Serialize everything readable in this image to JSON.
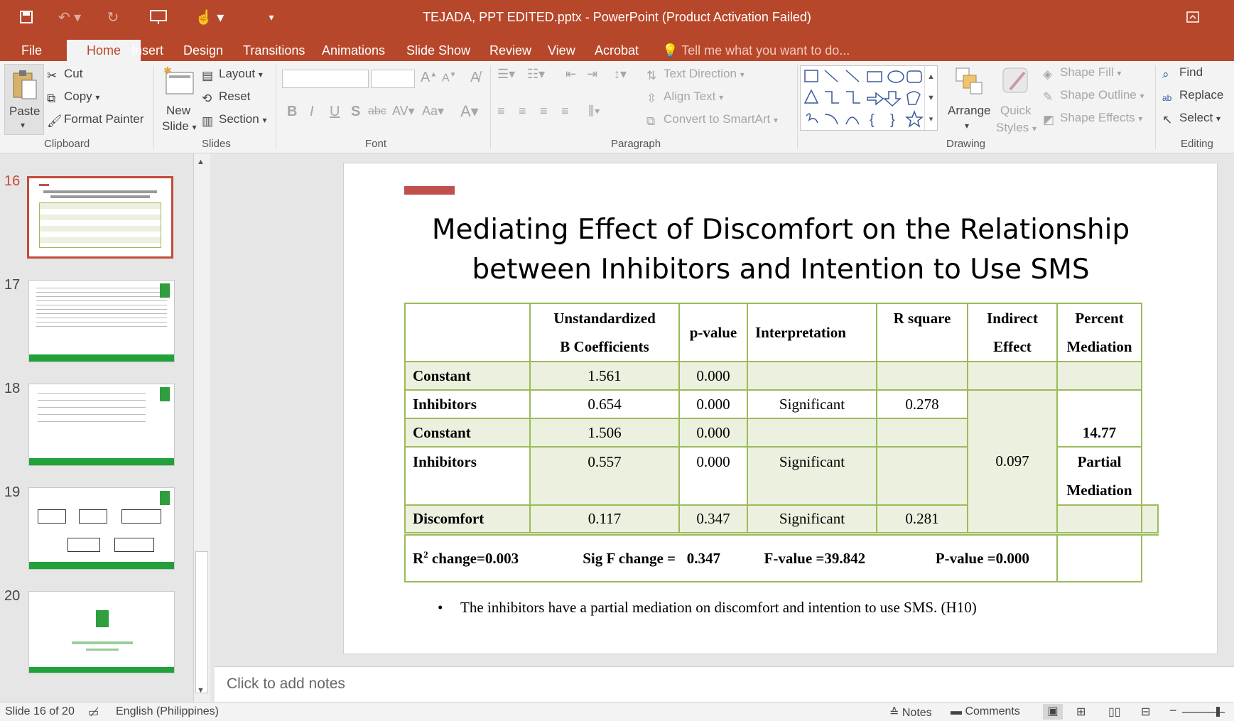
{
  "window": {
    "title": "TEJADA, PPT EDITED.pptx - PowerPoint (Product Activation Failed)"
  },
  "tabs": [
    "File",
    "Home",
    "Insert",
    "Design",
    "Transitions",
    "Animations",
    "Slide Show",
    "Review",
    "View",
    "Acrobat"
  ],
  "tell_me": "Tell me what you want to do...",
  "clipboard": {
    "paste": "Paste",
    "cut": "Cut",
    "copy": "Copy",
    "format_painter": "Format Painter",
    "group": "Clipboard"
  },
  "slides_grp": {
    "new": "New",
    "slide": "Slide",
    "layout": "Layout",
    "reset": "Reset",
    "section": "Section",
    "group": "Slides"
  },
  "font_grp": {
    "group": "Font"
  },
  "paragraph": {
    "text_direction": "Text Direction",
    "align_text": "Align Text",
    "convert": "Convert to SmartArt",
    "group": "Paragraph"
  },
  "drawing": {
    "arrange": "Arrange",
    "quick": "Quick",
    "styles": "Styles",
    "fill": "Shape Fill",
    "outline": "Shape Outline",
    "effects": "Shape Effects",
    "group": "Drawing"
  },
  "editing": {
    "find": "Find",
    "replace": "Replace",
    "select": "Select",
    "group": "Editing"
  },
  "thumbnails": [
    {
      "num": "16"
    },
    {
      "num": "17"
    },
    {
      "num": "18"
    },
    {
      "num": "19"
    },
    {
      "num": "20"
    }
  ],
  "slide": {
    "title_line1": "Mediating Effect of Discomfort on the Relationship",
    "title_line2": "between Inhibitors and Intention to Use SMS",
    "headers": {
      "coef1": "Unstandardized",
      "coef2": "B Coefficients",
      "pvalue": "p-value",
      "interp": "Interpretation",
      "rsq": "R square",
      "ind1": "Indirect",
      "ind2": "Effect",
      "pct1": "Percent",
      "pct2": "Mediation"
    },
    "rows": [
      {
        "label": "Constant",
        "coef": "1.561",
        "p": "0.000",
        "interp": "",
        "rsq": ""
      },
      {
        "label": "Inhibitors",
        "coef": "0.654",
        "p": "0.000",
        "interp": "Significant",
        "rsq": "0.278"
      },
      {
        "label": "Constant",
        "coef": "1.506",
        "p": "0.000",
        "interp": "",
        "rsq": ""
      },
      {
        "label": "Inhibitors",
        "coef": "0.557",
        "p": "0.000",
        "interp": "Significant",
        "rsq": ""
      },
      {
        "label": "Discomfort",
        "coef": "0.117",
        "p": "0.347",
        "interp": "Significant",
        "rsq": "0.281"
      }
    ],
    "indirect": "0.097",
    "percent": "14.77",
    "partial1": "Partial",
    "partial2": "Mediation",
    "footer": {
      "r2_label": "R",
      "r2_sup": "2",
      "r2_rest": " change=0.003",
      "sigf": "Sig F change =   0.347",
      "fval": "F-value =39.842",
      "pval": "P-value =0.000"
    },
    "bullet": "The inhibitors have a partial mediation on discomfort and intention to use SMS. (H10)"
  },
  "notes_placeholder": "Click to add notes",
  "status": {
    "slide": "Slide 16 of 20",
    "lang": "English (Philippines)",
    "notes": "Notes",
    "comments": "Comments"
  },
  "colors": {
    "accent": "#b7472a",
    "table_border": "#9bbb59",
    "table_fill": "#ebf1de",
    "slide_bar": "#c0504d"
  }
}
